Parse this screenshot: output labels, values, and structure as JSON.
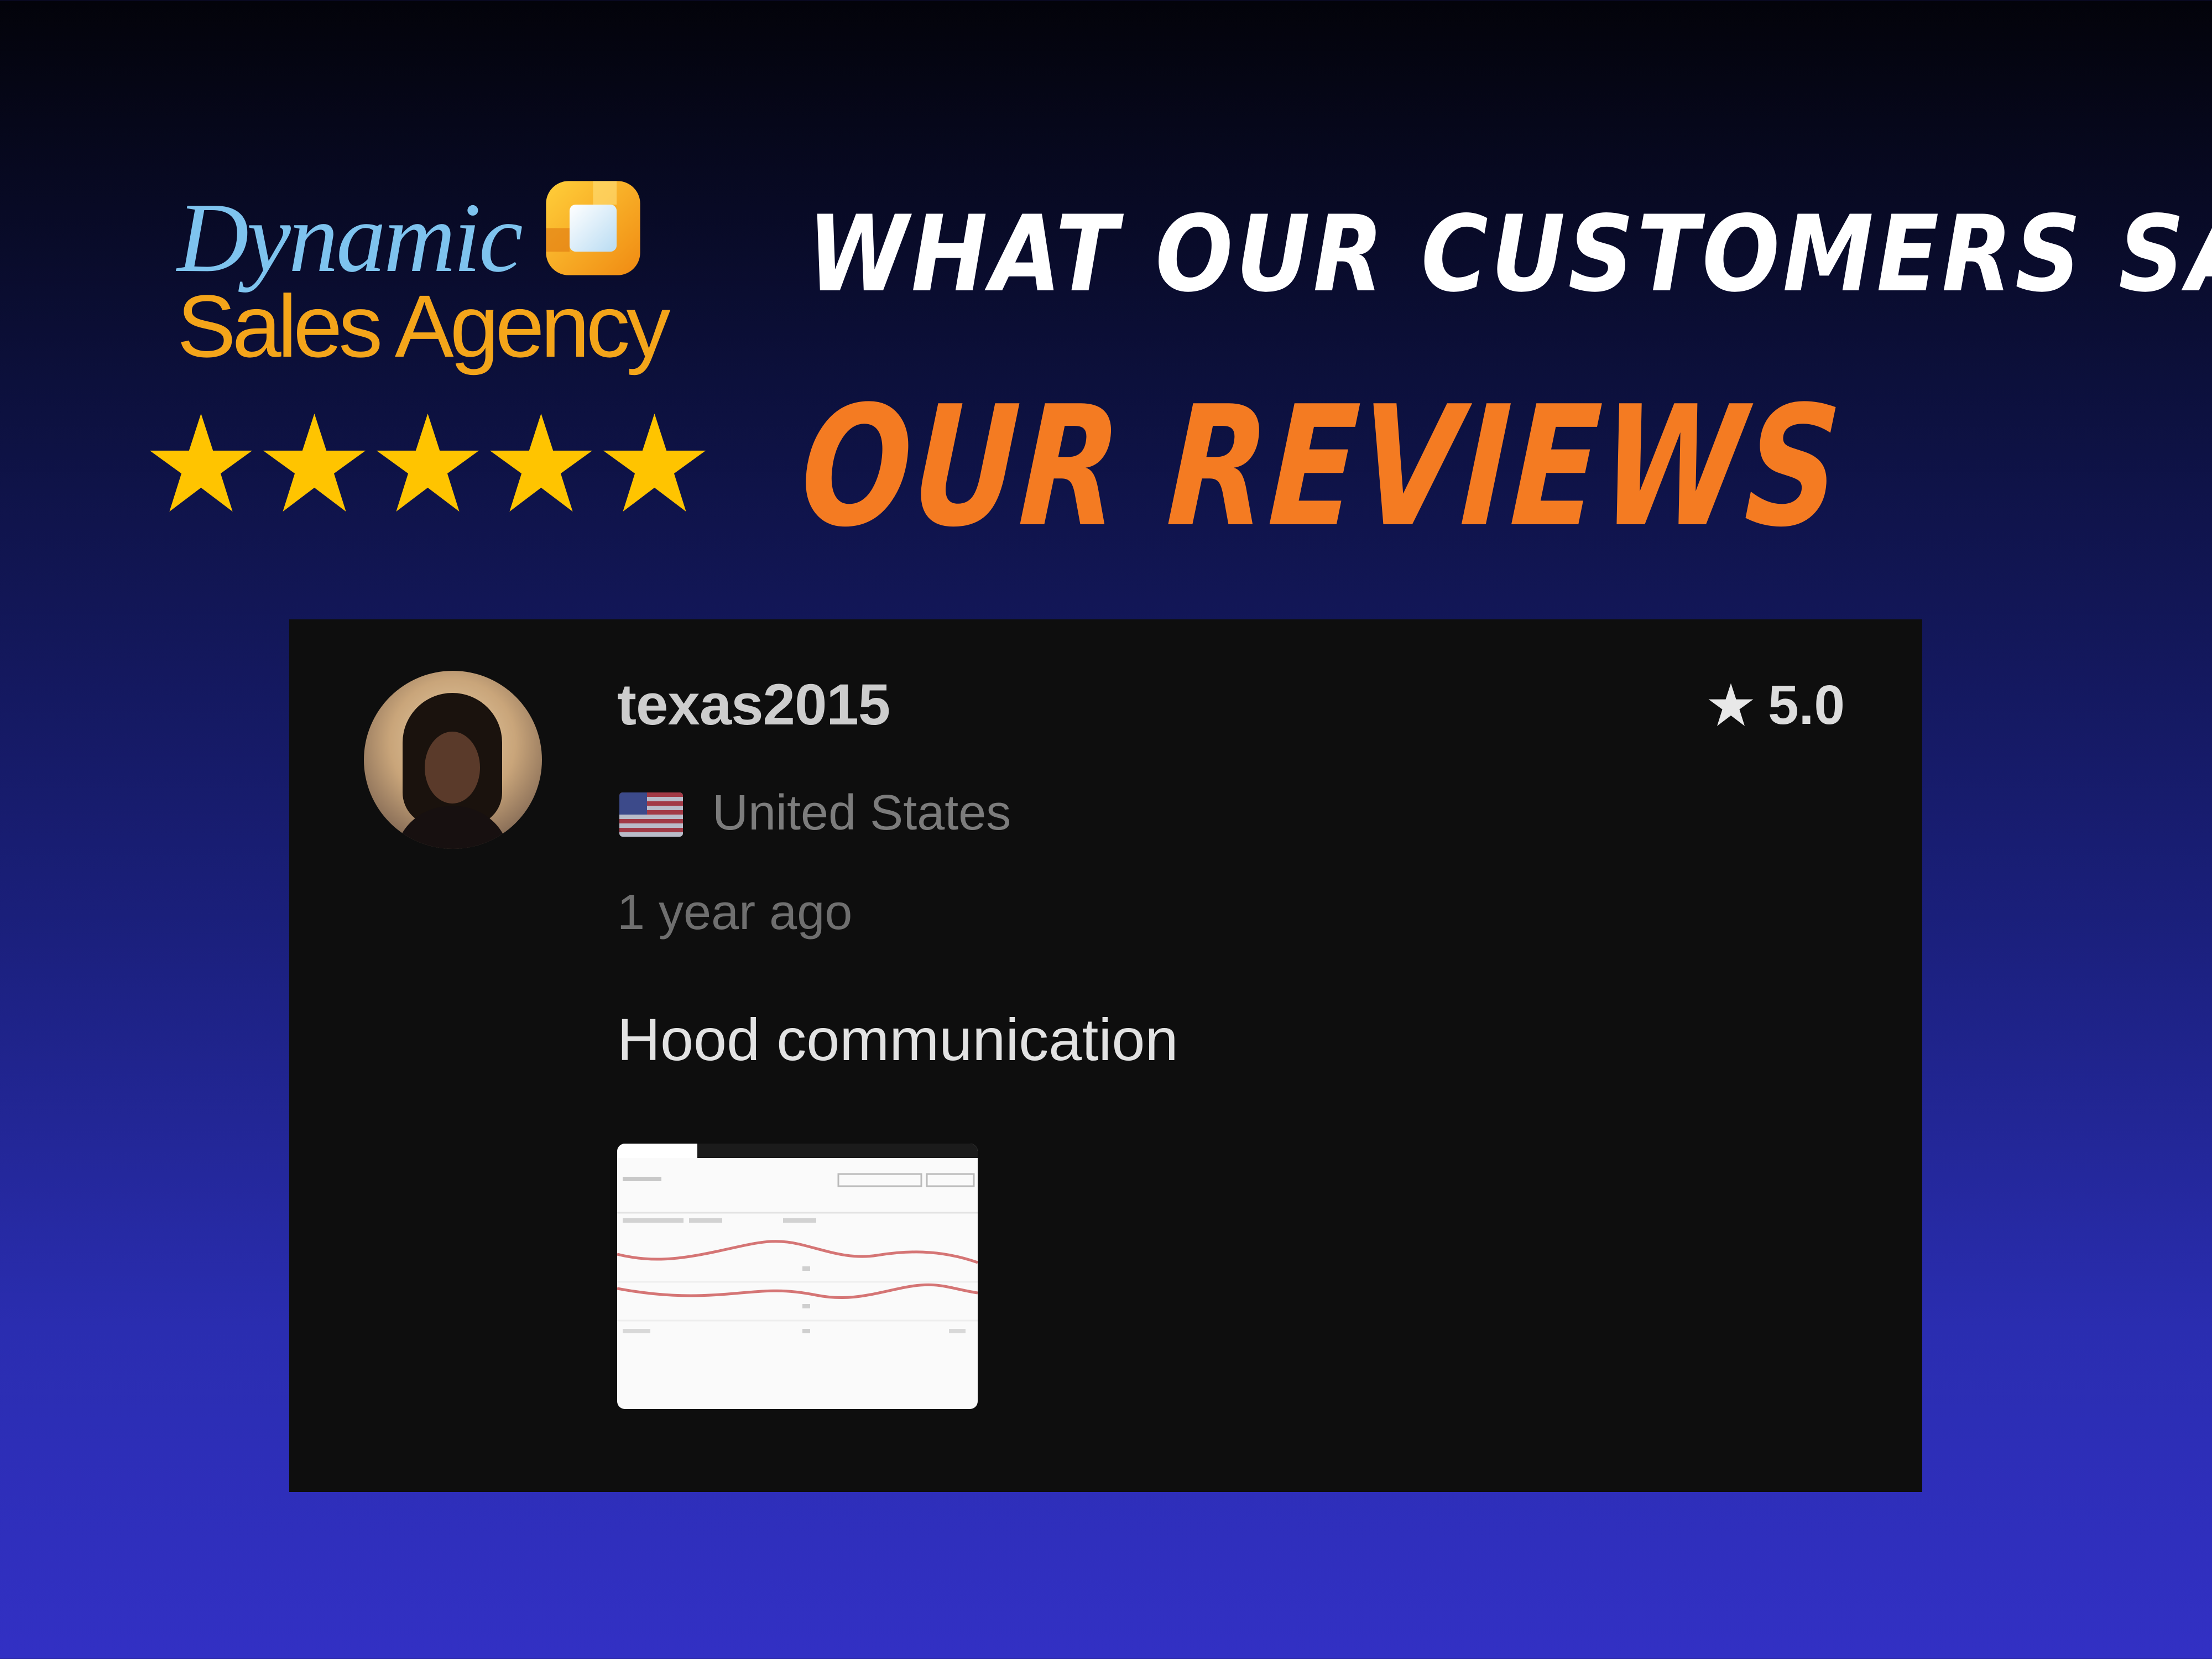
{
  "brand": {
    "line1": "Dynamic",
    "line2": "Sales Agency",
    "colors": {
      "blue": "#7ec3ee",
      "orange": "#f4a51a"
    }
  },
  "rating_stars": {
    "count": 5,
    "color": "#ffc400"
  },
  "headings": {
    "subtitle": "What our customers say",
    "title": "Our Reviews",
    "title_color": "#f47b22"
  },
  "review": {
    "username": "texas2015",
    "rating": "5.0",
    "country_flag": "us-flag-icon",
    "country": "United States",
    "time": "1 year ago",
    "text": "Hood communication",
    "attachment": "chart-screenshot-thumbnail"
  }
}
